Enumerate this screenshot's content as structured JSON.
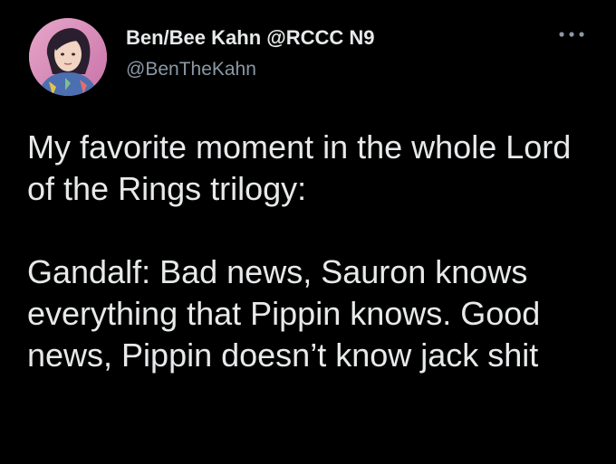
{
  "author": {
    "display_name": "Ben/Bee Kahn @RCCC N9",
    "handle": "@BenTheKahn",
    "avatar_icon": "profile-avatar-illustration"
  },
  "more_icon": "ellipsis-icon",
  "tweet": {
    "paragraphs": [
      "My favorite moment in the whole Lord of the Rings trilogy:",
      "Gandalf: Bad news, Sauron knows everything that Pippin knows. Good news, Pippin doesn’t know jack shit"
    ]
  },
  "colors": {
    "background": "#000000",
    "text": "#e7e9ea",
    "secondary_text": "#8b98a5"
  }
}
